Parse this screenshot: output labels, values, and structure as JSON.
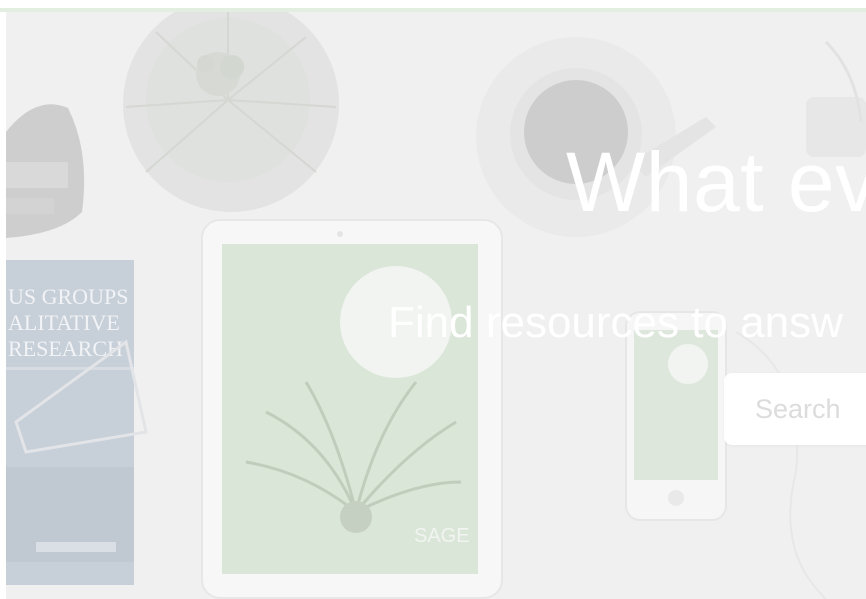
{
  "hero": {
    "headline": "What ev",
    "subheadline": "Find resources to answ"
  },
  "search": {
    "placeholder": "Search"
  },
  "book": {
    "title_lines": [
      "US GROUPS",
      "ALITATIVE",
      "RESEARCH"
    ]
  },
  "tablet": {
    "brand": "SAGE"
  },
  "colors": {
    "green_line": "#e2efe0",
    "background": "#ececec",
    "book_cover": "#aab7c5",
    "tablet_screen": "#c9dbc3"
  }
}
